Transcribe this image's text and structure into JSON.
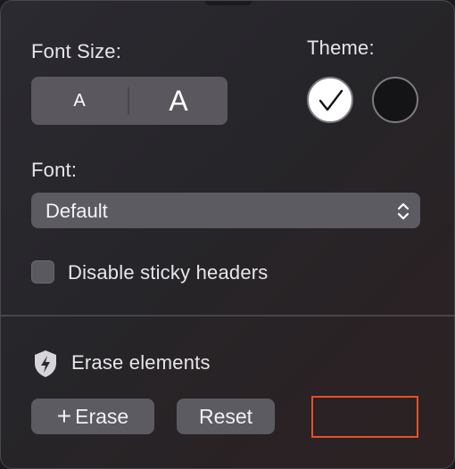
{
  "font_size": {
    "label": "Font Size:",
    "small_label": "A",
    "large_label": "A"
  },
  "theme": {
    "label": "Theme:",
    "options": [
      {
        "name": "light",
        "color": "#ffffff",
        "selected": true
      },
      {
        "name": "dark",
        "color": "#141416",
        "selected": false
      }
    ]
  },
  "font": {
    "label": "Font:",
    "selected": "Default"
  },
  "sticky_headers": {
    "label": "Disable sticky headers",
    "checked": false
  },
  "erase": {
    "heading": "Erase elements",
    "icon": "shield-bolt-icon",
    "erase_button": {
      "icon": "plus-icon",
      "plus": "+",
      "label": "Erase"
    },
    "reset_button": "Reset"
  },
  "colors": {
    "highlight": "#e6512a",
    "control_bg": "#5d5b62"
  }
}
